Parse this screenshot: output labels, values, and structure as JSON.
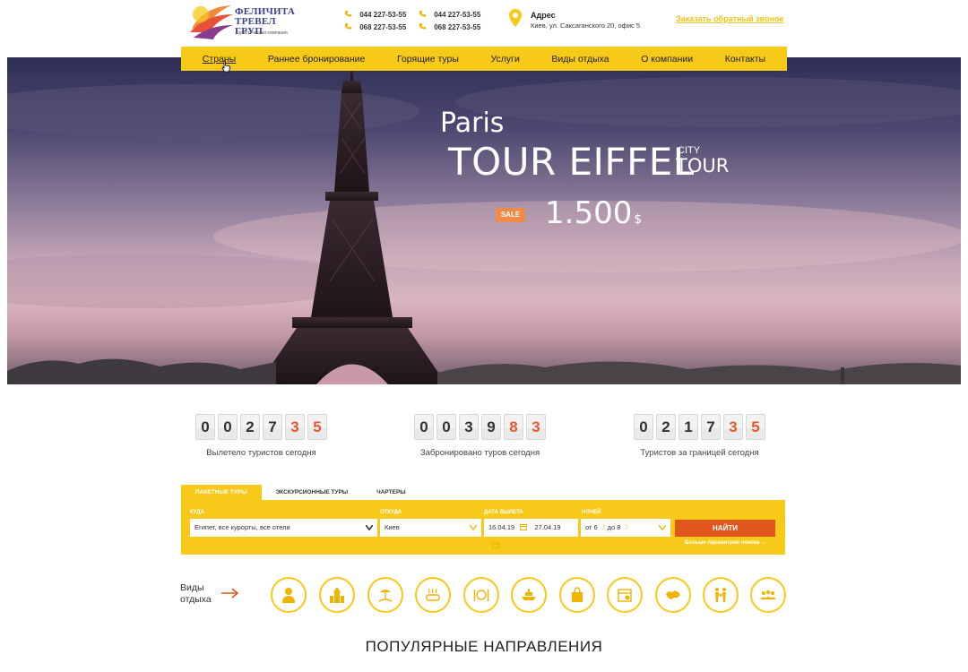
{
  "header": {
    "logo": {
      "name_line1": "ФЕЛИЧИТА",
      "name_line2": "ТРЕВЕЛ ГРУП",
      "tagline": "Туристическая компания"
    },
    "phones": [
      "044 227-53-55",
      "068 227-53-55",
      "044 227-53-55",
      "068 227-53-55"
    ],
    "address_title": "Адрес",
    "address_text": "Киев, ул. Саксаганского 20, офис 5",
    "callback_link": "Заказать обратный звонок"
  },
  "nav": {
    "items": [
      "Страны",
      "Раннее бронирование",
      "Горящие туры",
      "Услуги",
      "Виды отдыха",
      "О компании",
      "Контакты"
    ],
    "active_index": 0
  },
  "hero": {
    "city": "Paris",
    "title": "TOUR EIFFEL",
    "subtitle_small": "CITY",
    "subtitle_big": "TOUR",
    "badge": "SALE",
    "price": "1.500",
    "currency": "$"
  },
  "counters": [
    {
      "digits": [
        "0",
        "0",
        "2",
        "7",
        "3",
        "5"
      ],
      "highlight_from": 4,
      "label": "Вылетело туристов сегодня"
    },
    {
      "digits": [
        "0",
        "0",
        "3",
        "9",
        "8",
        "3"
      ],
      "highlight_from": 4,
      "label": "Забронировано туров сегодня"
    },
    {
      "digits": [
        "0",
        "2",
        "1",
        "7",
        "3",
        "5"
      ],
      "highlight_from": 4,
      "label": "Туристов за границей сегодня"
    }
  ],
  "search": {
    "tabs": [
      "ПАКЕТНЫЕ ТУРЫ",
      "ЭКСКУРСИОННЫЕ ТУРЫ",
      "ЧАРТЕРЫ"
    ],
    "active_tab": 0,
    "labels": {
      "where": "КУДА",
      "from": "ОТКУДА",
      "date": "ДАТА ВЫЛЕТА",
      "nights": "НОЧЕЙ"
    },
    "values": {
      "where": "Египет, все курорты, все отели",
      "from": "Киев",
      "date_from": "16.04.19",
      "date_to": "27.04.19",
      "nights_from": "от 6",
      "nights_to": "до 8"
    },
    "submit": "НАЙТИ",
    "more": "Больше параметров поиска"
  },
  "vacation_types": {
    "label_line1": "Виды",
    "label_line2": "отдыха",
    "icons": [
      "person-icon",
      "church-icon",
      "beach-icon",
      "spa-icon",
      "restaurant-icon",
      "cruise-icon",
      "shopping-icon",
      "calendar-icon",
      "country-map-icon",
      "family-icon",
      "group-icon"
    ]
  },
  "popular_title": "ПОПУЛЯРНЫЕ НАПРАВЛЕНИЯ",
  "colors": {
    "accent": "#f7c919",
    "button": "#e1561d",
    "highlight_digit": "#e2592a",
    "logo_text": "#3a3f8f"
  }
}
